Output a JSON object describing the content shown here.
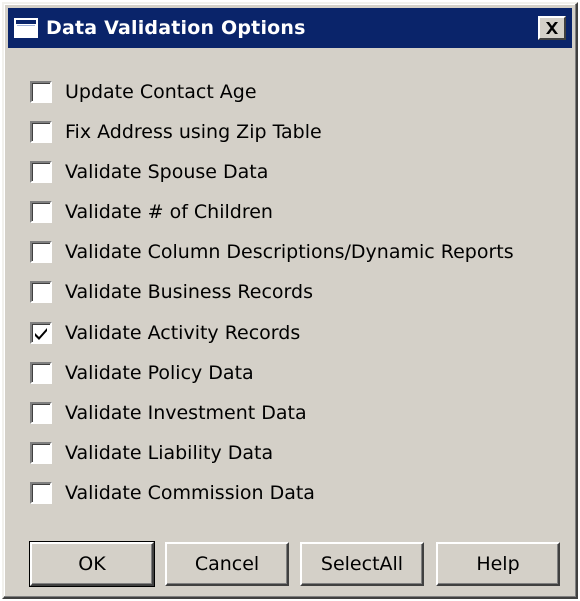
{
  "window": {
    "title": "Data Validation Options",
    "colors": {
      "titlebar": "#0a246a",
      "face": "#d4d0c8"
    },
    "icons": {
      "app": "window-icon",
      "close": "close-icon",
      "check": "checkmark-icon"
    }
  },
  "options": [
    {
      "label": "Update Contact Age",
      "checked": false
    },
    {
      "label": "Fix Address using Zip Table",
      "checked": false
    },
    {
      "label": "Validate Spouse Data",
      "checked": false
    },
    {
      "label": "Validate # of Children",
      "checked": false
    },
    {
      "label": "Validate Column Descriptions/Dynamic Reports",
      "checked": false
    },
    {
      "label": "Validate Business Records",
      "checked": false
    },
    {
      "label": "Validate Activity Records",
      "checked": true
    },
    {
      "label": "Validate Policy Data",
      "checked": false
    },
    {
      "label": "Validate Investment Data",
      "checked": false
    },
    {
      "label": "Validate Liability Data",
      "checked": false
    },
    {
      "label": "Validate Commission Data",
      "checked": false
    }
  ],
  "buttons": {
    "ok": "OK",
    "cancel": "Cancel",
    "select_all": "SelectAll",
    "help": "Help"
  }
}
